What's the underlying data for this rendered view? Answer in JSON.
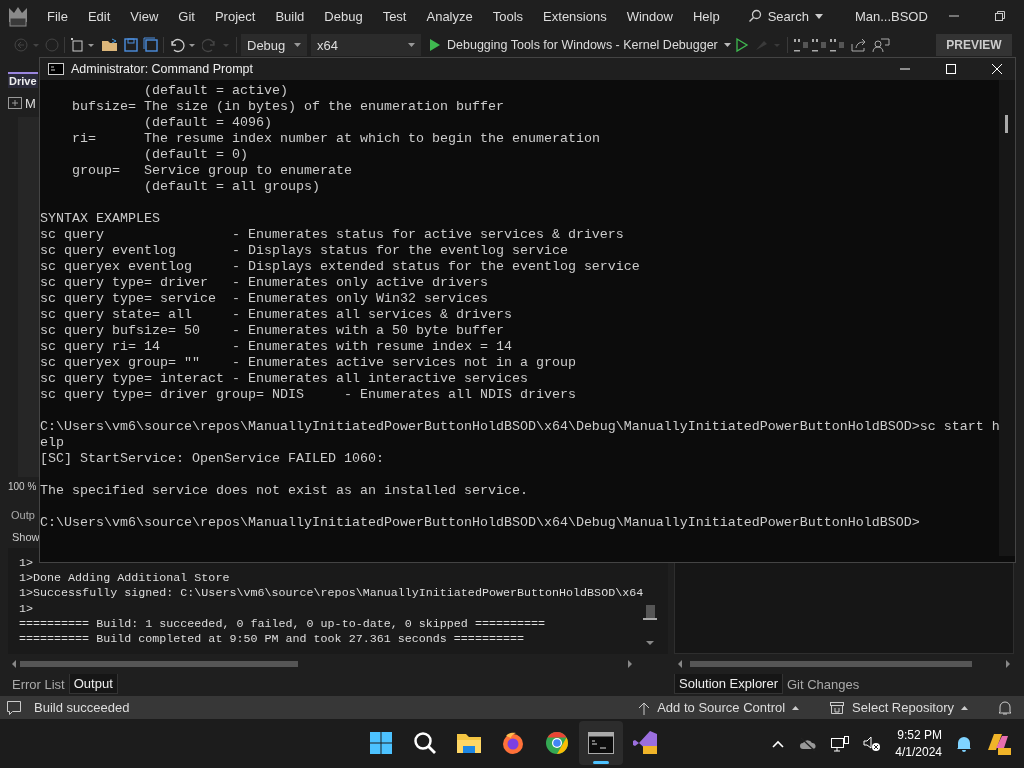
{
  "ide": {
    "menu": [
      "File",
      "Edit",
      "View",
      "Git",
      "Project",
      "Build",
      "Debug",
      "Test",
      "Analyze",
      "Tools",
      "Extensions",
      "Window",
      "Help"
    ],
    "search": "Search",
    "solution_name": "Man...BSOD",
    "toolbar": {
      "configuration": "Debug",
      "platform": "x64",
      "debug_target": "Debugging Tools for Windows - Kernel Debugger",
      "preview_label": "PREVIEW"
    },
    "side_tab": "Drive",
    "side_item": "M",
    "zoom": "100 %",
    "output": {
      "title": "Outp",
      "show_label": "Show",
      "lines": [
        "1>",
        "1>Done Adding Additional Store",
        "1>Successfully signed: C:\\Users\\vm6\\source\\repos\\ManuallyInitiatedPowerButtonHoldBSOD\\x64",
        "1>",
        "========== Build: 1 succeeded, 0 failed, 0 up-to-date, 0 skipped ==========",
        "========== Build completed at 9:50 PM and took 27.361 seconds =========="
      ]
    },
    "bottom_tabs": [
      {
        "label": "Error List",
        "selected": false
      },
      {
        "label": "Output",
        "selected": true
      }
    ],
    "right_tabs": [
      {
        "label": "Solution Explorer",
        "selected": true
      },
      {
        "label": "Git Changes",
        "selected": false
      }
    ],
    "status": {
      "message": "Build succeeded",
      "source_control": "Add to Source Control",
      "repository": "Select Repository"
    }
  },
  "console": {
    "title": "Administrator: Command Prompt",
    "blocks": [
      {
        "lines": [
          "             (default = active)",
          "    bufsize= The size (in bytes) of the enumeration buffer",
          "             (default = 4096)",
          "    ri=      The resume index number at which to begin the enumeration",
          "             (default = 0)",
          "    group=   Service group to enumerate",
          "             (default = all groups)"
        ]
      },
      {
        "lines": [
          "SYNTAX EXAMPLES",
          "sc query                - Enumerates status for active services & drivers",
          "sc query eventlog       - Displays status for the eventlog service",
          "sc queryex eventlog     - Displays extended status for the eventlog service",
          "sc query type= driver   - Enumerates only active drivers",
          "sc query type= service  - Enumerates only Win32 services",
          "sc query state= all     - Enumerates all services & drivers",
          "sc query bufsize= 50    - Enumerates with a 50 byte buffer",
          "sc query ri= 14         - Enumerates with resume index = 14",
          "sc queryex group= \"\"    - Enumerates active services not in a group",
          "sc query type= interact - Enumerates all interactive services",
          "sc query type= driver group= NDIS     - Enumerates all NDIS drivers"
        ]
      },
      {
        "lines": [
          "C:\\Users\\vm6\\source\\repos\\ManuallyInitiatedPowerButtonHoldBSOD\\x64\\Debug\\ManuallyInitiatedPowerButtonHoldBSOD>sc start help",
          "[SC] StartService: OpenService FAILED 1060:"
        ]
      },
      {
        "lines": [
          "The specified service does not exist as an installed service."
        ]
      },
      {
        "lines": [
          "C:\\Users\\vm6\\source\\repos\\ManuallyInitiatedPowerButtonHoldBSOD\\x64\\Debug\\ManuallyInitiatedPowerButtonHoldBSOD>"
        ]
      }
    ]
  },
  "taskbar": {
    "apps": [
      {
        "kind": "start",
        "selected": false
      },
      {
        "kind": "search",
        "selected": false
      },
      {
        "kind": "files",
        "selected": false
      },
      {
        "kind": "firefox",
        "selected": false
      },
      {
        "kind": "chrome",
        "selected": false
      },
      {
        "kind": "terminal",
        "selected": true
      },
      {
        "kind": "studio",
        "selected": false
      }
    ],
    "time": "9:52 PM",
    "date": "4/1/2024"
  }
}
